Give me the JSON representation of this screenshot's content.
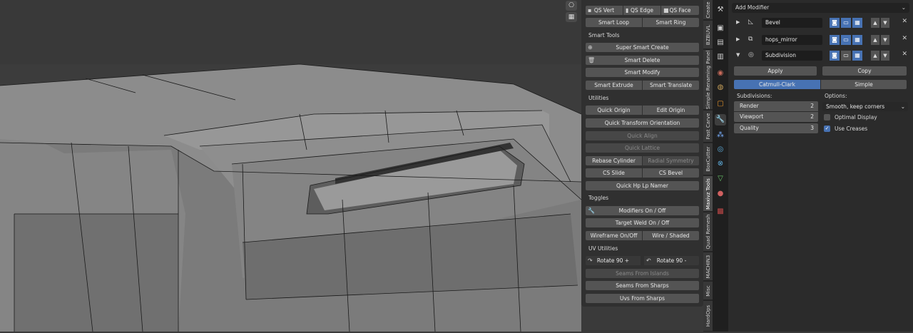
{
  "viewport": {
    "gizmo": [
      "camera-icon",
      "grid-icon"
    ]
  },
  "npanel": {
    "qs_vert": "QS Vert",
    "qs_edge": "QS Edge",
    "qs_face": "QS Face",
    "smart_loop": "Smart Loop",
    "smart_ring": "Smart Ring",
    "smart_tools_header": "Smart Tools",
    "super_smart_create": "Super Smart Create",
    "smart_delete": "Smart Delete",
    "smart_modify": "Smart Modify",
    "smart_extrude": "Smart Extrude",
    "smart_translate": "Smart Translate",
    "utilities_header": "Utilities",
    "quick_origin": "Quick Origin",
    "edit_origin": "Edit Origin",
    "quick_transform_orientation": "Quick Transform Orientation",
    "quick_align": "Quick Align",
    "quick_lattice": "Quick Lattice",
    "rebase_cylinder": "Rebase Cylinder",
    "radial_symmetry": "Radial Symmetry",
    "cs_slide": "CS Slide",
    "cs_bevel": "CS Bevel",
    "quick_hp_lp_namer": "Quick Hp Lp Namer",
    "toggles_header": "Toggles",
    "modifiers_on_off": "Modifiers On / Off",
    "target_weld_on_off": "Target Weld On / Off",
    "wireframe_on_off": "Wireframe On/Off",
    "wire_shaded": "Wire / Shaded",
    "uv_utilities_header": "UV Utilities",
    "rotate_plus": "Rotate 90 +",
    "rotate_minus": "Rotate 90 -",
    "seams_from_islands": "Seams From Islands",
    "seams_from_sharps": "Seams From Sharps",
    "uvs_from_sharps": "Uvs From Sharps"
  },
  "vtabs": [
    "Create",
    "BZBUVL",
    "Simple Renaming Panel",
    "Fast Carve",
    "BoxCutter",
    "Maxivz Tools",
    "Quad Remesh",
    "MACHIN3",
    "Misc",
    "HardOps"
  ],
  "props": {
    "add_modifier": "Add Modifier",
    "modifiers": [
      {
        "name": "Bevel",
        "icon": "bevel-icon"
      },
      {
        "name": "hops_mirror",
        "icon": "mirror-icon"
      },
      {
        "name": "Subdivision",
        "icon": "subdivision-icon"
      }
    ],
    "apply": "Apply",
    "copy": "Copy",
    "catmull_clark": "Catmull-Clark",
    "simple": "Simple",
    "subdivisions_label": "Subdivisions:",
    "options_label": "Options:",
    "render_label": "Render",
    "render_value": "2",
    "viewport_label": "Viewport",
    "viewport_value": "2",
    "quality_label": "Quality",
    "quality_value": "3",
    "uv_smooth": "Smooth, keep corners",
    "optimal_display": "Optimal Display",
    "use_creases": "Use Creases"
  }
}
